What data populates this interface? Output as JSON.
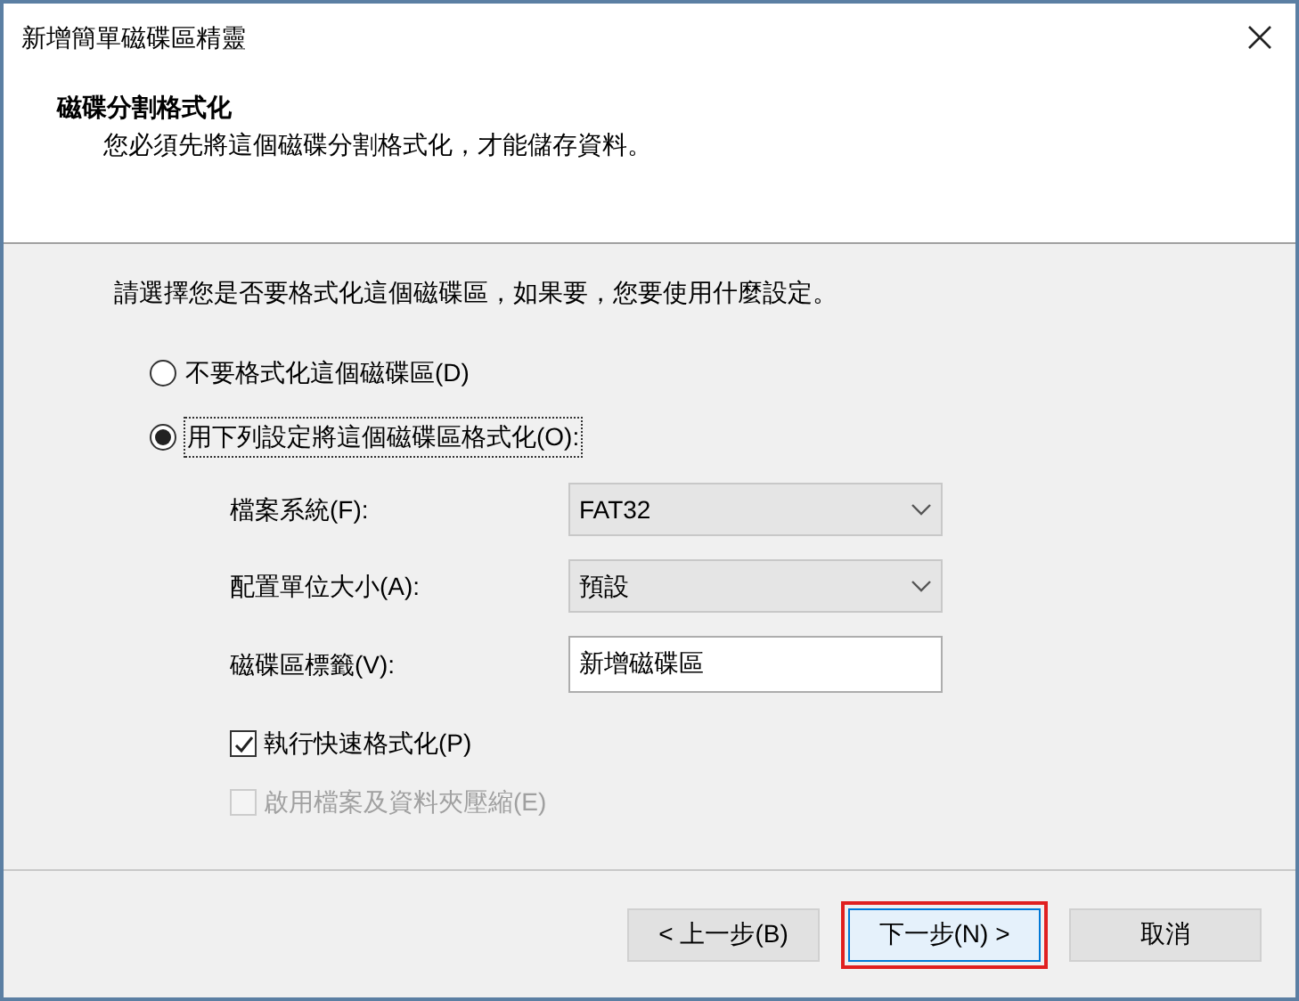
{
  "window": {
    "title": "新增簡單磁碟區精靈"
  },
  "header": {
    "title": "磁碟分割格式化",
    "subtitle": "您必須先將這個磁碟分割格式化，才能儲存資料。"
  },
  "prompt": "請選擇您是否要格式化這個磁碟區，如果要，您要使用什麼設定。",
  "options": [
    {
      "label": "不要格式化這個磁碟區(D)",
      "selected": false
    },
    {
      "label": "用下列設定將這個磁碟區格式化(O):",
      "selected": true
    }
  ],
  "settings": [
    {
      "label": "檔案系統(F):",
      "kind": "select",
      "value": "FAT32"
    },
    {
      "label": "配置單位大小(A):",
      "kind": "select",
      "value": "預設"
    },
    {
      "label": "磁碟區標籤(V):",
      "kind": "text",
      "value": "新增磁碟區"
    }
  ],
  "checkboxes": [
    {
      "label": "執行快速格式化(P)",
      "checked": true,
      "disabled": false
    },
    {
      "label": "啟用檔案及資料夾壓縮(E)",
      "checked": false,
      "disabled": true
    }
  ],
  "buttons": [
    {
      "label": "< 上一步(B)",
      "default": false,
      "highlighted": false
    },
    {
      "label": "下一步(N) >",
      "default": true,
      "highlighted": true
    },
    {
      "label": "取消",
      "default": false,
      "highlighted": false
    }
  ]
}
